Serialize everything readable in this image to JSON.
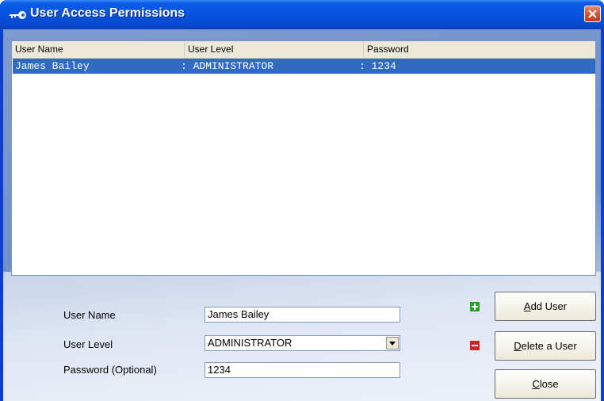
{
  "window": {
    "title": "User Access Permissions"
  },
  "list": {
    "columns": [
      "User Name",
      "User Level",
      "Password"
    ],
    "rows": [
      {
        "name": "James Bailey",
        "level": ": ADMINISTRATOR",
        "password": ": 1234",
        "selected": true
      }
    ]
  },
  "form": {
    "user_name_label": "User Name",
    "user_name_value": "James Bailey",
    "user_level_label": "User Level",
    "user_level_value": "ADMINISTRATOR",
    "password_label": "Password (Optional)",
    "password_value": "1234"
  },
  "buttons": {
    "add": {
      "mnemonic": "A",
      "rest": "dd User"
    },
    "delete": {
      "mnemonic": "D",
      "rest": "elete a User"
    },
    "close": {
      "mnemonic": "C",
      "rest": "lose"
    }
  },
  "colors": {
    "selection": "#316ac5",
    "add_icon": "#2e9a2e",
    "delete_icon": "#d8202a",
    "titlebar": "#0754e0"
  },
  "icons": {
    "title": "key-icon",
    "add": "plus-icon",
    "delete": "minus-icon",
    "close": "close-icon"
  }
}
